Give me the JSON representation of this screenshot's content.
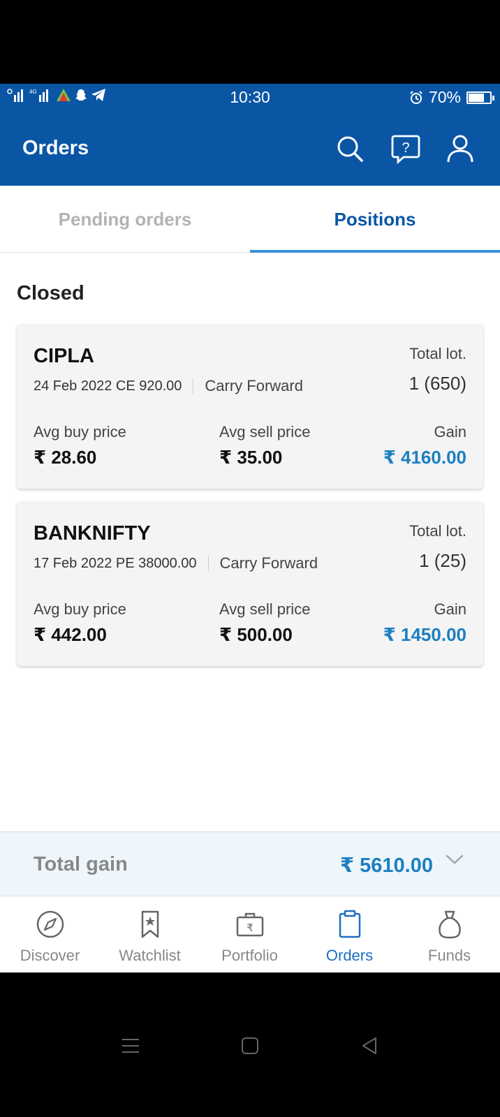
{
  "status": {
    "time": "10:30",
    "battery": "70%",
    "battery_level": 0.7,
    "icons": [
      "signal-icon",
      "signal-4g-icon",
      "app-icon",
      "snapchat-icon",
      "telegram-icon",
      "alarm-icon",
      "battery-icon"
    ]
  },
  "header": {
    "title": "Orders",
    "icons": [
      "search-icon",
      "help-icon",
      "profile-icon"
    ]
  },
  "tabs": [
    {
      "label": "Pending orders",
      "active": false
    },
    {
      "label": "Positions",
      "active": true
    }
  ],
  "section": {
    "title": "Closed"
  },
  "positions": [
    {
      "symbol": "CIPLA",
      "contract": "24 Feb 2022 CE 920.00",
      "type": "Carry Forward",
      "total_label": "Total lot.",
      "lots": "1 (650)",
      "avg_buy_label": "Avg buy price",
      "avg_buy": "₹ 28.60",
      "avg_sell_label": "Avg sell price",
      "avg_sell": "₹ 35.00",
      "gain_label": "Gain",
      "gain": "₹ 4160.00"
    },
    {
      "symbol": "BANKNIFTY",
      "contract": "17 Feb 2022 PE 38000.00",
      "type": "Carry Forward",
      "total_label": "Total lot.",
      "lots": "1 (25)",
      "avg_buy_label": "Avg buy price",
      "avg_buy": "₹ 442.00",
      "avg_sell_label": "Avg sell price",
      "avg_sell": "₹ 500.00",
      "gain_label": "Gain",
      "gain": "₹ 1450.00"
    }
  ],
  "total": {
    "label": "Total gain",
    "value": "₹ 5610.00"
  },
  "nav": [
    {
      "label": "Discover",
      "icon": "compass-icon",
      "active": false
    },
    {
      "label": "Watchlist",
      "icon": "bookmark-icon",
      "active": false
    },
    {
      "label": "Portfolio",
      "icon": "briefcase-icon",
      "active": false
    },
    {
      "label": "Orders",
      "icon": "clipboard-icon",
      "active": true
    },
    {
      "label": "Funds",
      "icon": "money-bag-icon",
      "active": false
    }
  ],
  "colors": {
    "brand": "#0a56a5",
    "tab_indicator": "#3d8fdb",
    "gain": "#1c7fc0",
    "nav_active": "#1c6fc0",
    "nav_inactive": "#888888"
  }
}
